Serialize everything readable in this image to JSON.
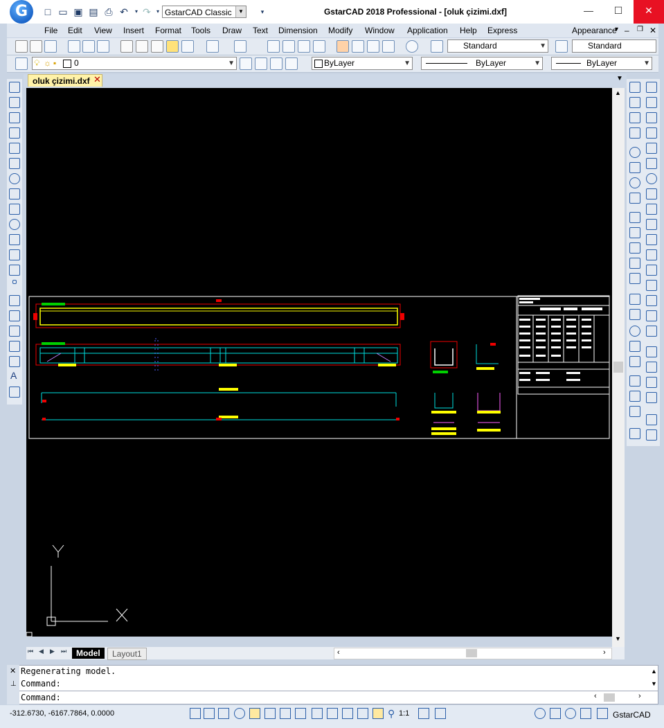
{
  "title_bar": {
    "logo_letter": "G",
    "workspace": "GstarCAD Classic",
    "window_title": "GstarCAD 2018 Professional - [oluk çizimi.dxf]"
  },
  "menu": {
    "items": [
      "File",
      "Edit",
      "View",
      "Insert",
      "Format",
      "Tools",
      "Draw",
      "Text",
      "Dimension",
      "Modify",
      "Window",
      "Application",
      "Help",
      "Express"
    ],
    "appearance": "Appearance"
  },
  "toolbar": {
    "text_style": "Standard",
    "dim_style": "Standard",
    "layer": "0",
    "color": "ByLayer",
    "linetype": "ByLayer",
    "lineweight": "ByLayer"
  },
  "document": {
    "tab_label": "oluk çizimi.dxf"
  },
  "layout_tabs": {
    "model": "Model",
    "layout1": "Layout1"
  },
  "ucs": {
    "x_label": "X",
    "y_label": "Y"
  },
  "command": {
    "line1": "Regenerating model.",
    "line2": "Command:",
    "line3": "Command:"
  },
  "status": {
    "coordinates": "-312.6730, -6167.7864, 0.0000",
    "scale": "1:1",
    "product": "GstarCAD"
  },
  "colors": {
    "accent": "#1c66c9",
    "canvas": "#000000",
    "close": "#e81123"
  },
  "icons": [
    "new-icon",
    "open-icon",
    "save-icon",
    "print-icon",
    "undo-icon",
    "redo-icon",
    "pan-icon",
    "zoom-icon",
    "line-icon",
    "circle-icon",
    "arc-icon",
    "text-icon",
    "erase-icon",
    "copy-icon",
    "move-icon",
    "rotate-icon"
  ]
}
